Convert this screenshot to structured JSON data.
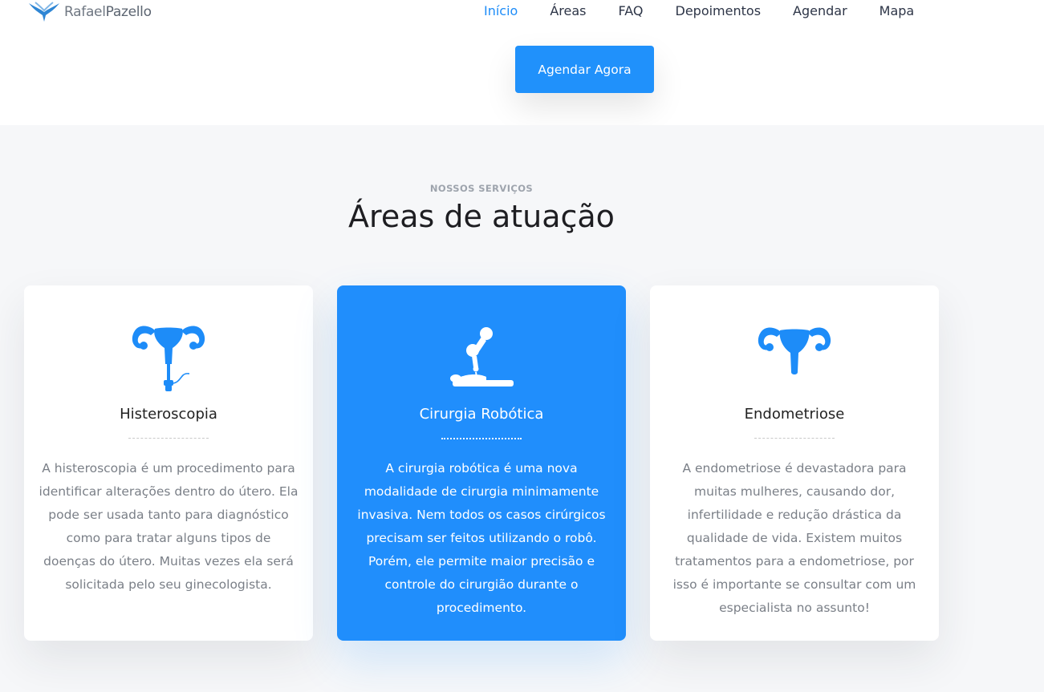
{
  "brand": {
    "name_light": "Rafael",
    "name_bold": "Pazello",
    "logo_icon": "rp-logo-icon",
    "color": "#2f86d4"
  },
  "nav": {
    "items": [
      {
        "label": "Início",
        "active": true
      },
      {
        "label": "Áreas"
      },
      {
        "label": "FAQ"
      },
      {
        "label": "Depoimentos"
      },
      {
        "label": "Agendar"
      },
      {
        "label": "Mapa"
      }
    ]
  },
  "cta": {
    "label": "Agendar Agora"
  },
  "services": {
    "eyebrow": "NOSSOS SERVIÇOS",
    "title": "Áreas de atuação",
    "cards": [
      {
        "icon": "uterus-speculum-icon",
        "name": "Histeroscopia",
        "description": "A histeroscopia é um procedimento para identificar alterações dentro do útero. Ela pode ser usada tanto para diagnóstico como para tratar alguns tipos de doenças do útero. Muitas vezes ela será solicitada pelo seu ginecologista."
      },
      {
        "icon": "robotic-surgery-icon",
        "name": "Cirurgia Robótica",
        "description": "A cirurgia robótica é uma nova modalidade de cirurgia minimamente invasiva. Nem todos os casos cirúrgicos precisam ser feitos utilizando o robô. Porém, ele permite maior precisão e controle do cirurgião durante o procedimento."
      },
      {
        "icon": "uterus-icon",
        "name": "Endometriose",
        "description": "A endometriose é devastadora para muitas mulheres, causando dor, infertilidade e redução drástica da qualidade de vida. Existem muitos tratamentos para a endometriose, por isso é importante se consultar com um especialista no assunto!"
      }
    ]
  },
  "colors": {
    "accent": "#208efc",
    "section_bg": "#f6f7f9"
  }
}
